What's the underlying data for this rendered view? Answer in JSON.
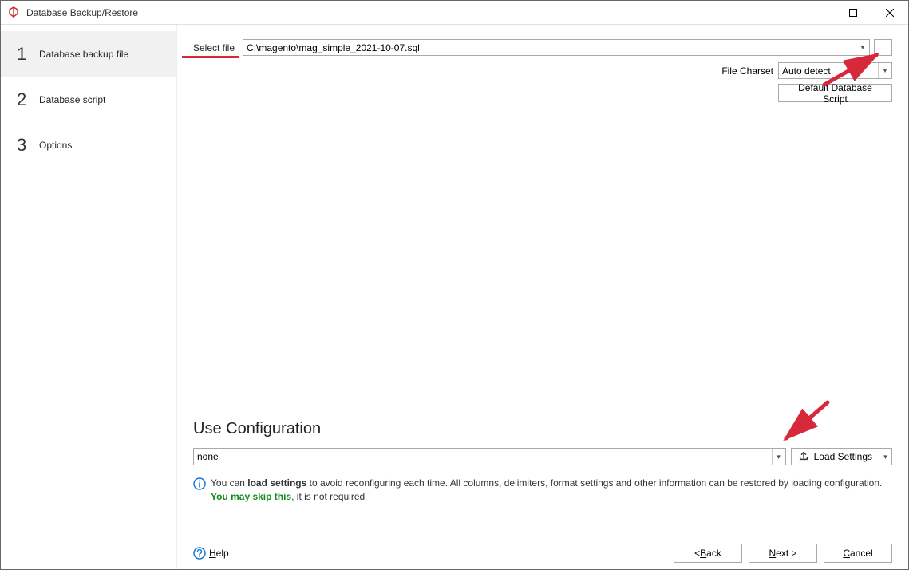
{
  "title": "Database Backup/Restore",
  "steps": [
    {
      "num": "1",
      "label": "Database backup file",
      "active": true
    },
    {
      "num": "2",
      "label": "Database script",
      "active": false
    },
    {
      "num": "3",
      "label": "Options",
      "active": false
    }
  ],
  "selectFile": {
    "label": "Select file",
    "value": "C:\\magento\\mag_simple_2021-10-07.sql",
    "browse": "..."
  },
  "charset": {
    "label": "File Charset",
    "value": "Auto detect"
  },
  "defaultScriptBtn": "Default Database Script",
  "config": {
    "title": "Use Configuration",
    "value": "none",
    "loadBtn": "Load Settings"
  },
  "info": {
    "pre": "You can ",
    "bold1": "load settings",
    "mid": " to avoid reconfiguring each time. All columns, delimiters, format settings and other information can be restored by loading configuration. ",
    "green": "You may skip this",
    "post": ", it is not required"
  },
  "help": {
    "letter": "H",
    "rest": "elp"
  },
  "buttons": {
    "back": {
      "lt": "< ",
      "u": "B",
      "rest": "ack"
    },
    "next": {
      "u": "N",
      "rest": "ext >"
    },
    "cancel": {
      "u": "C",
      "rest": "ancel"
    }
  }
}
